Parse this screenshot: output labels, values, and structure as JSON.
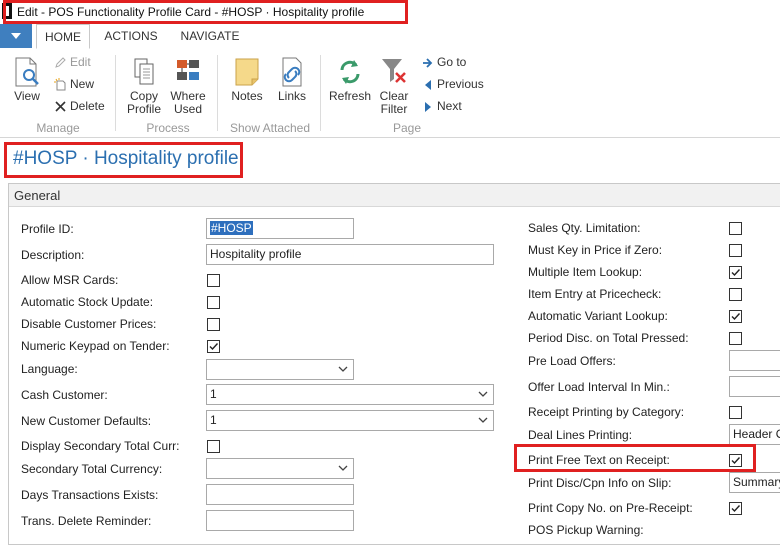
{
  "window": {
    "title": "Edit - POS Functionality Profile Card - #HOSP · Hospitality profile"
  },
  "ribbon": {
    "tabs": [
      "HOME",
      "ACTIONS",
      "NAVIGATE"
    ],
    "buttons": {
      "view": "View",
      "edit": "Edit",
      "new": "New",
      "delete": "Delete",
      "copy_profile": "Copy Profile",
      "where_used": "Where Used",
      "notes": "Notes",
      "links": "Links",
      "refresh": "Refresh",
      "clear_filter": "Clear Filter",
      "go_to": "Go to",
      "previous": "Previous",
      "next": "Next"
    },
    "groups": [
      "Manage",
      "Process",
      "Show Attached",
      "Page"
    ]
  },
  "page": {
    "title": "#HOSP · Hospitality profile"
  },
  "general": {
    "header": "General",
    "left": {
      "profile_id_label": "Profile ID:",
      "profile_id_value": "#HOSP",
      "description_label": "Description:",
      "description_value": "Hospitality profile",
      "allow_msr_label": "Allow MSR Cards:",
      "auto_stock_label": "Automatic Stock Update:",
      "disable_cust_prices_label": "Disable Customer Prices:",
      "numeric_keypad_label": "Numeric Keypad on Tender:",
      "language_label": "Language:",
      "language_value": "",
      "cash_customer_label": "Cash Customer:",
      "cash_customer_value": "1",
      "new_cust_defaults_label": "New Customer Defaults:",
      "new_cust_defaults_value": "1",
      "display_sec_total_label": "Display Secondary Total Curr:",
      "sec_total_currency_label": "Secondary Total Currency:",
      "sec_total_currency_value": "",
      "days_trans_label": "Days Transactions Exists:",
      "days_trans_value": "",
      "trans_delete_label": "Trans. Delete Reminder:",
      "trans_delete_value": ""
    },
    "left_checks": {
      "allow_msr": false,
      "auto_stock": false,
      "disable_cust_prices": false,
      "numeric_keypad": true,
      "display_sec_total": false
    },
    "right": {
      "sales_qty_label": "Sales Qty. Limitation:",
      "must_key_price_label": "Must Key in Price if Zero:",
      "multi_item_lookup_label": "Multiple Item Lookup:",
      "item_entry_label": "Item Entry at Pricecheck:",
      "auto_variant_label": "Automatic Variant Lookup:",
      "period_disc_label": "Period Disc. on Total Pressed:",
      "preload_offers_label": "Pre Load Offers:",
      "preload_offers_value": "",
      "offer_load_label": "Offer Load Interval In Min.:",
      "offer_load_value": "",
      "receipt_print_cat_label": "Receipt Printing by Category:",
      "deal_lines_label": "Deal Lines Printing:",
      "deal_lines_value": "Header O",
      "print_free_text_label": "Print Free Text on Receipt:",
      "print_disc_label": "Print Disc/Cpn Info on Slip:",
      "print_disc_value": "Summary",
      "print_copy_label": "Print Copy No. on Pre-Receipt:",
      "pos_pickup_label": "POS Pickup Warning:"
    },
    "right_checks": {
      "sales_qty": false,
      "must_key_price": false,
      "multi_item_lookup": true,
      "item_entry": false,
      "auto_variant": true,
      "period_disc": false,
      "receipt_print_cat": false,
      "print_free_text": true,
      "print_copy": true
    },
    "colors": {
      "accent": "#2b6fb0",
      "highlight": "#e02020"
    }
  }
}
